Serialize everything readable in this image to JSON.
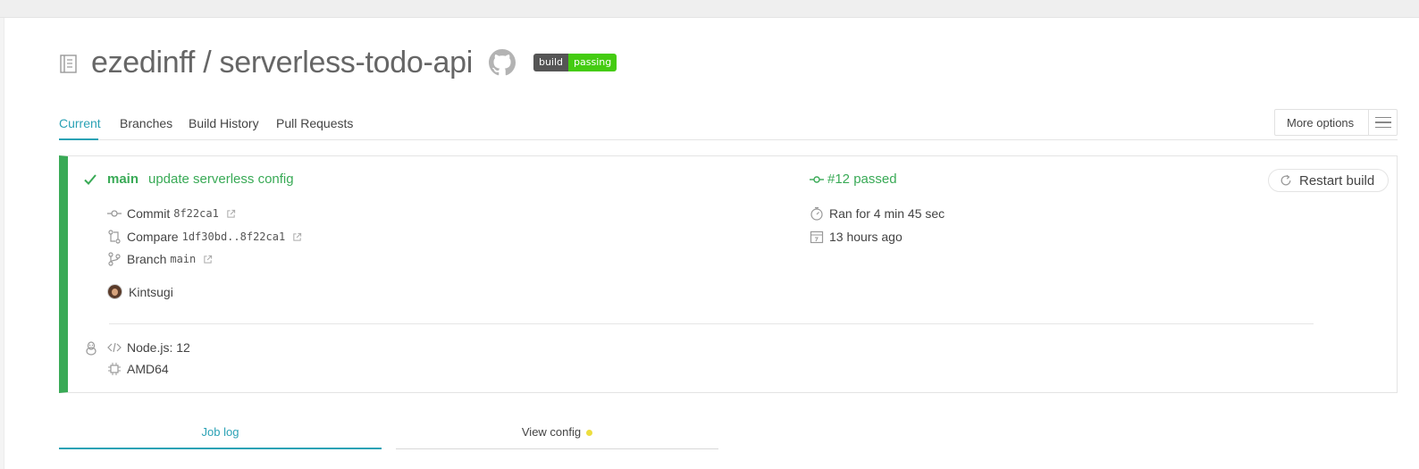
{
  "repo": {
    "owner": "ezedinff",
    "separator": "/",
    "name": "serverless-todo-api",
    "badge_left": "build",
    "badge_right": "passing"
  },
  "tabs": [
    {
      "label": "Current",
      "active": true
    },
    {
      "label": "Branches",
      "active": false
    },
    {
      "label": "Build History",
      "active": false
    },
    {
      "label": "Pull Requests",
      "active": false
    }
  ],
  "more_options_label": "More options",
  "build": {
    "status": "passed",
    "branch": "main",
    "message": "update serverless config",
    "number_label": "#12 passed",
    "commit_label": "Commit",
    "commit_sha": "8f22ca1",
    "compare_label": "Compare",
    "compare_range": "1df30bd..8f22ca1",
    "branch_label": "Branch",
    "branch_value": "main",
    "author": "Kintsugi",
    "duration": "Ran for 4 min 45 sec",
    "finished": "13 hours ago",
    "restart_label": "Restart build",
    "language": "Node.js: 12",
    "arch": "AMD64"
  },
  "bottom_tabs": {
    "job_log": "Job log",
    "view_config": "View config"
  },
  "colors": {
    "passed": "#39aa56",
    "accent": "#2ba2b5",
    "config_dot": "#edde3f"
  }
}
